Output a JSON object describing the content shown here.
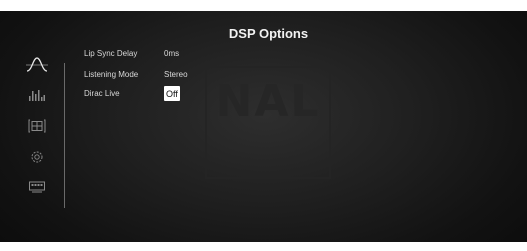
{
  "title": "DSP Options",
  "watermark": "NAL",
  "sidebar": {
    "items": [
      {
        "icon": "sine-wave-icon",
        "active": true
      },
      {
        "icon": "equalizer-icon",
        "active": false
      },
      {
        "icon": "speaker-layout-icon",
        "active": false
      },
      {
        "icon": "settings-gear-icon",
        "active": false
      },
      {
        "icon": "display-icon",
        "active": false
      }
    ]
  },
  "options": [
    {
      "label": "Lip Sync Delay",
      "value": "0ms"
    },
    {
      "label": "Listening Mode",
      "value": "Stereo"
    },
    {
      "label": "Dirac Live",
      "value": "Off",
      "selected": true
    }
  ],
  "colors": {
    "text": "#d9d9d9",
    "title": "#f2f2f2",
    "icon_active": "#e0e0e0",
    "icon_inactive": "#8a8a8a",
    "selection_bg": "#ffffff"
  }
}
